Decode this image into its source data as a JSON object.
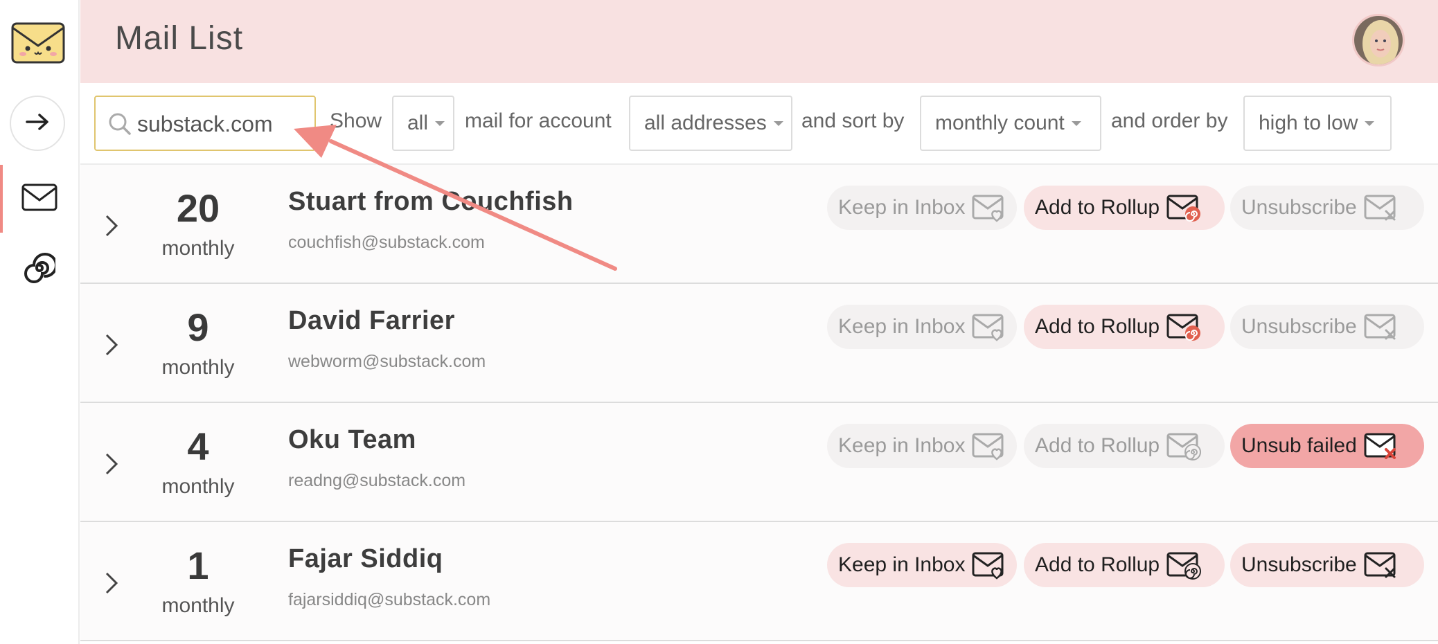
{
  "header": {
    "title": "Mail List"
  },
  "search": {
    "value": "substack.com",
    "placeholder": ""
  },
  "filters": {
    "show_label": "Show",
    "show_value": "all",
    "account_label": "mail for account",
    "account_value": "all addresses",
    "sort_label": "and sort by",
    "sort_value": "monthly count",
    "order_label": "and order by",
    "order_value": "high to low"
  },
  "rows": [
    {
      "count": "20",
      "period": "monthly",
      "sender": "Stuart from Couchfish",
      "email": "couchfish@substack.com",
      "keep": "Keep in Inbox",
      "rollup": "Add to Rollup",
      "unsub": "Unsubscribe",
      "keep_state": "muted",
      "rollup_state": "active",
      "unsub_state": "muted"
    },
    {
      "count": "9",
      "period": "monthly",
      "sender": "David Farrier",
      "email": "webworm@substack.com",
      "keep": "Keep in Inbox",
      "rollup": "Add to Rollup",
      "unsub": "Unsubscribe",
      "keep_state": "muted",
      "rollup_state": "active",
      "unsub_state": "muted"
    },
    {
      "count": "4",
      "period": "monthly",
      "sender": "Oku Team",
      "email": "readng@substack.com",
      "keep": "Keep in Inbox",
      "rollup": "Add to Rollup",
      "unsub": "Unsub failed",
      "keep_state": "muted",
      "rollup_state": "muted",
      "unsub_state": "failed"
    },
    {
      "count": "1",
      "period": "monthly",
      "sender": "Fajar Siddiq",
      "email": "fajarsiddiq@substack.com",
      "keep": "Keep in Inbox",
      "rollup": "Add to Rollup",
      "unsub": "Unsubscribe",
      "keep_state": "pending",
      "rollup_state": "pending",
      "unsub_state": "pending"
    }
  ],
  "icons": {
    "logo": "envelope-mascot-icon",
    "nav_forward": "arrow-right-icon",
    "nav_mail": "envelope-icon",
    "nav_rollup": "spiral-icon",
    "search": "search-icon",
    "keep": "envelope-heart-icon",
    "rollup": "envelope-spiral-icon",
    "unsub": "envelope-x-icon"
  },
  "colors": {
    "header_bg": "#f8e1e1",
    "accent": "#f08a84",
    "pill_pink": "#f9e3e3",
    "pill_failed": "#f2a6a6",
    "search_border": "#e0c56e",
    "annotation_arrow": "#f08a84"
  }
}
